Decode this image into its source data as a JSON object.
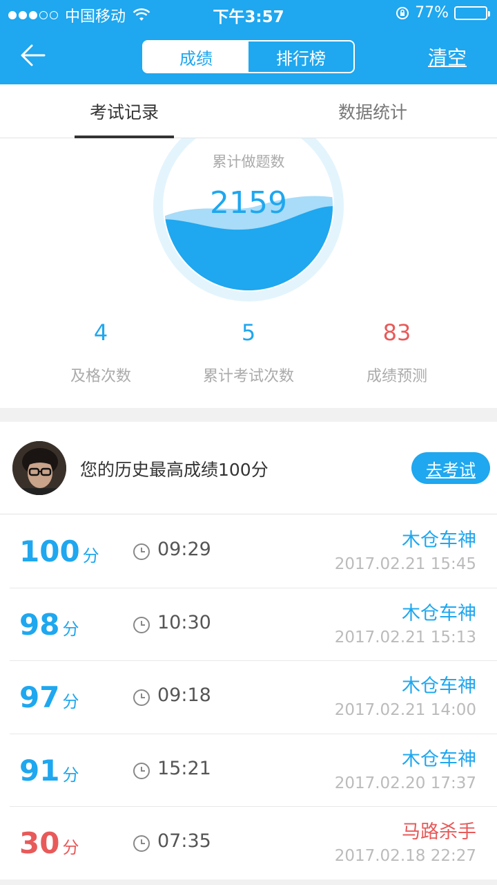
{
  "status_bar": {
    "carrier": "中国移动",
    "time": "下午3:57",
    "battery_percent": "77%",
    "battery_level": 0.77,
    "signal_bars": 3
  },
  "nav": {
    "segments": [
      "成绩",
      "排行榜"
    ],
    "active_segment": "成绩",
    "clear_label": "清空"
  },
  "tabs": [
    "考试记录",
    "数据统计"
  ],
  "summary": {
    "label": "累计做题数",
    "value": "2159"
  },
  "stats": [
    {
      "value": "4",
      "label": "及格次数",
      "color": "#1fa7ef"
    },
    {
      "value": "5",
      "label": "累计考试次数",
      "color": "#1fa7ef"
    },
    {
      "value": "83",
      "label": "成绩预测",
      "color": "#e85a5a"
    }
  ],
  "best": {
    "text": "您的历史最高成绩100分",
    "button_label": "去考试"
  },
  "records": [
    {
      "score": "100",
      "unit": "分",
      "duration": "09:29",
      "user": "木仓车神",
      "date": "2017.02.21 15:45",
      "status": "pass"
    },
    {
      "score": "98",
      "unit": "分",
      "duration": "10:30",
      "user": "木仓车神",
      "date": "2017.02.21 15:13",
      "status": "pass"
    },
    {
      "score": "97",
      "unit": "分",
      "duration": "09:18",
      "user": "木仓车神",
      "date": "2017.02.21 14:00",
      "status": "pass"
    },
    {
      "score": "91",
      "unit": "分",
      "duration": "15:21",
      "user": "木仓车神",
      "date": "2017.02.20 17:37",
      "status": "pass"
    },
    {
      "score": "30",
      "unit": "分",
      "duration": "07:35",
      "user": "马路杀手",
      "date": "2017.02.18 22:27",
      "status": "fail"
    }
  ],
  "colors": {
    "accent": "#1fa7ef",
    "fail": "#e85a5a"
  }
}
